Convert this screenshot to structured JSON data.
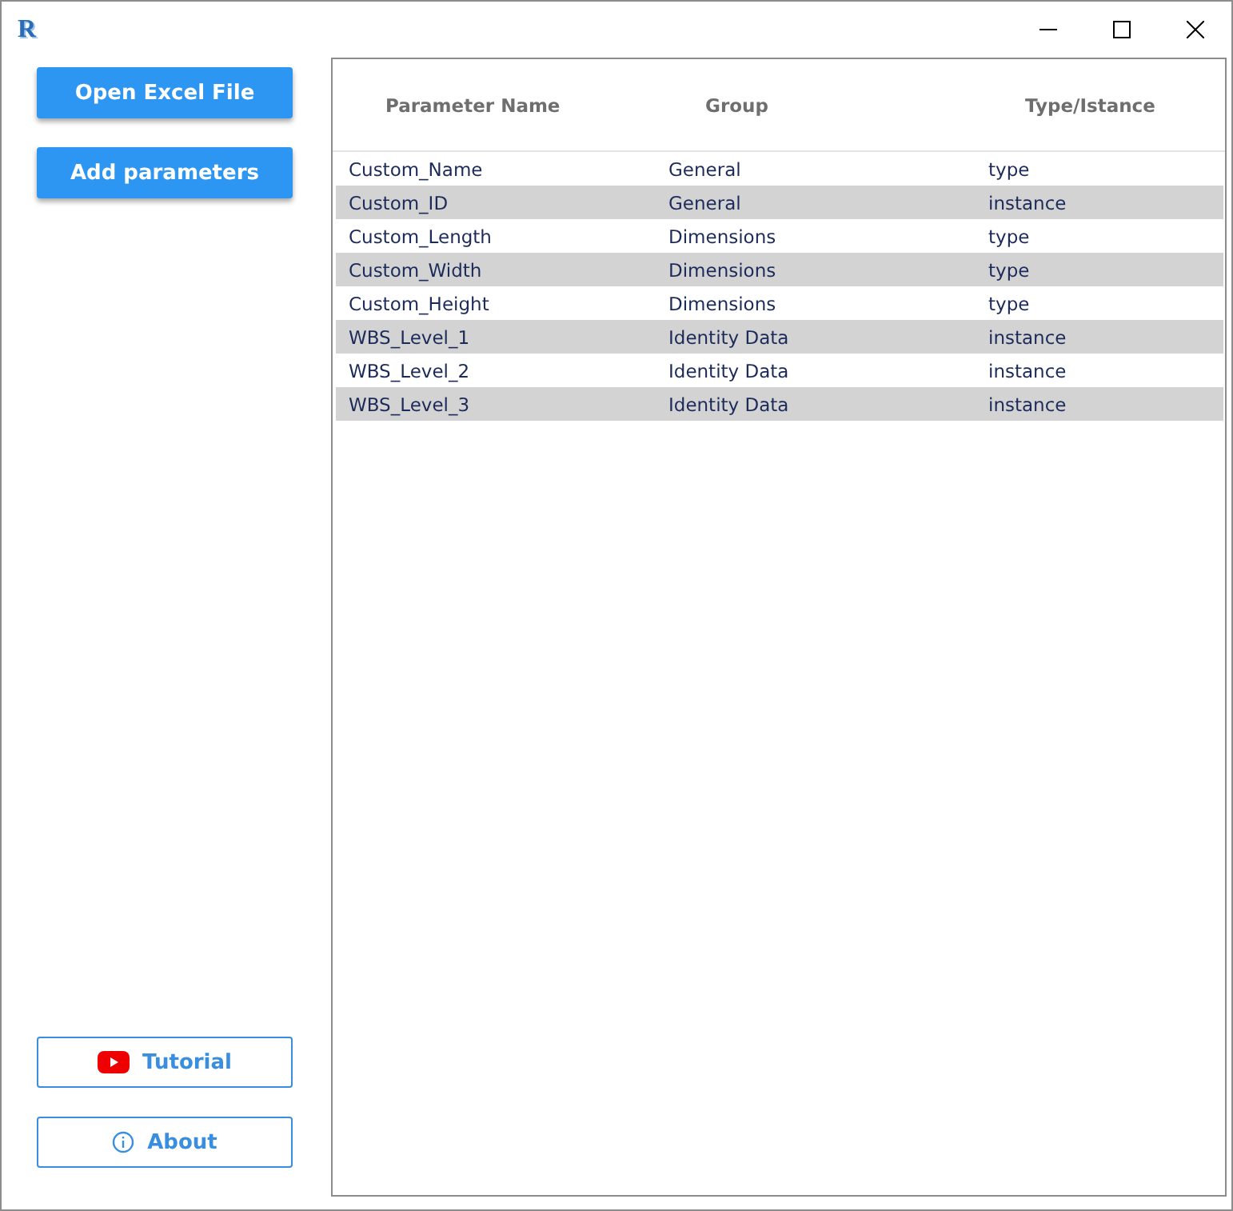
{
  "window": {
    "app_letter": "R",
    "controls": [
      {
        "kind": "minimize"
      },
      {
        "kind": "maximize"
      },
      {
        "kind": "close"
      }
    ]
  },
  "sidebar": {
    "actions": [
      {
        "label": "Open Excel File"
      },
      {
        "label": "Add parameters"
      }
    ],
    "links": [
      {
        "label": "Tutorial",
        "kind": "video"
      },
      {
        "label": "About",
        "kind": "info"
      }
    ]
  },
  "table": {
    "columns": [
      "Parameter Name",
      "Group",
      "Type/Istance"
    ],
    "rows": [
      [
        "Custom_Name",
        "General",
        "type"
      ],
      [
        "Custom_ID",
        "General",
        "instance"
      ],
      [
        "Custom_Length",
        "Dimensions",
        "type"
      ],
      [
        "Custom_Width",
        "Dimensions",
        "type"
      ],
      [
        "Custom_Height",
        "Dimensions",
        "type"
      ],
      [
        "WBS_Level_1",
        "Identity Data",
        "instance"
      ],
      [
        "WBS_Level_2",
        "Identity Data",
        "instance"
      ],
      [
        "WBS_Level_3",
        "Identity Data",
        "instance"
      ]
    ]
  }
}
